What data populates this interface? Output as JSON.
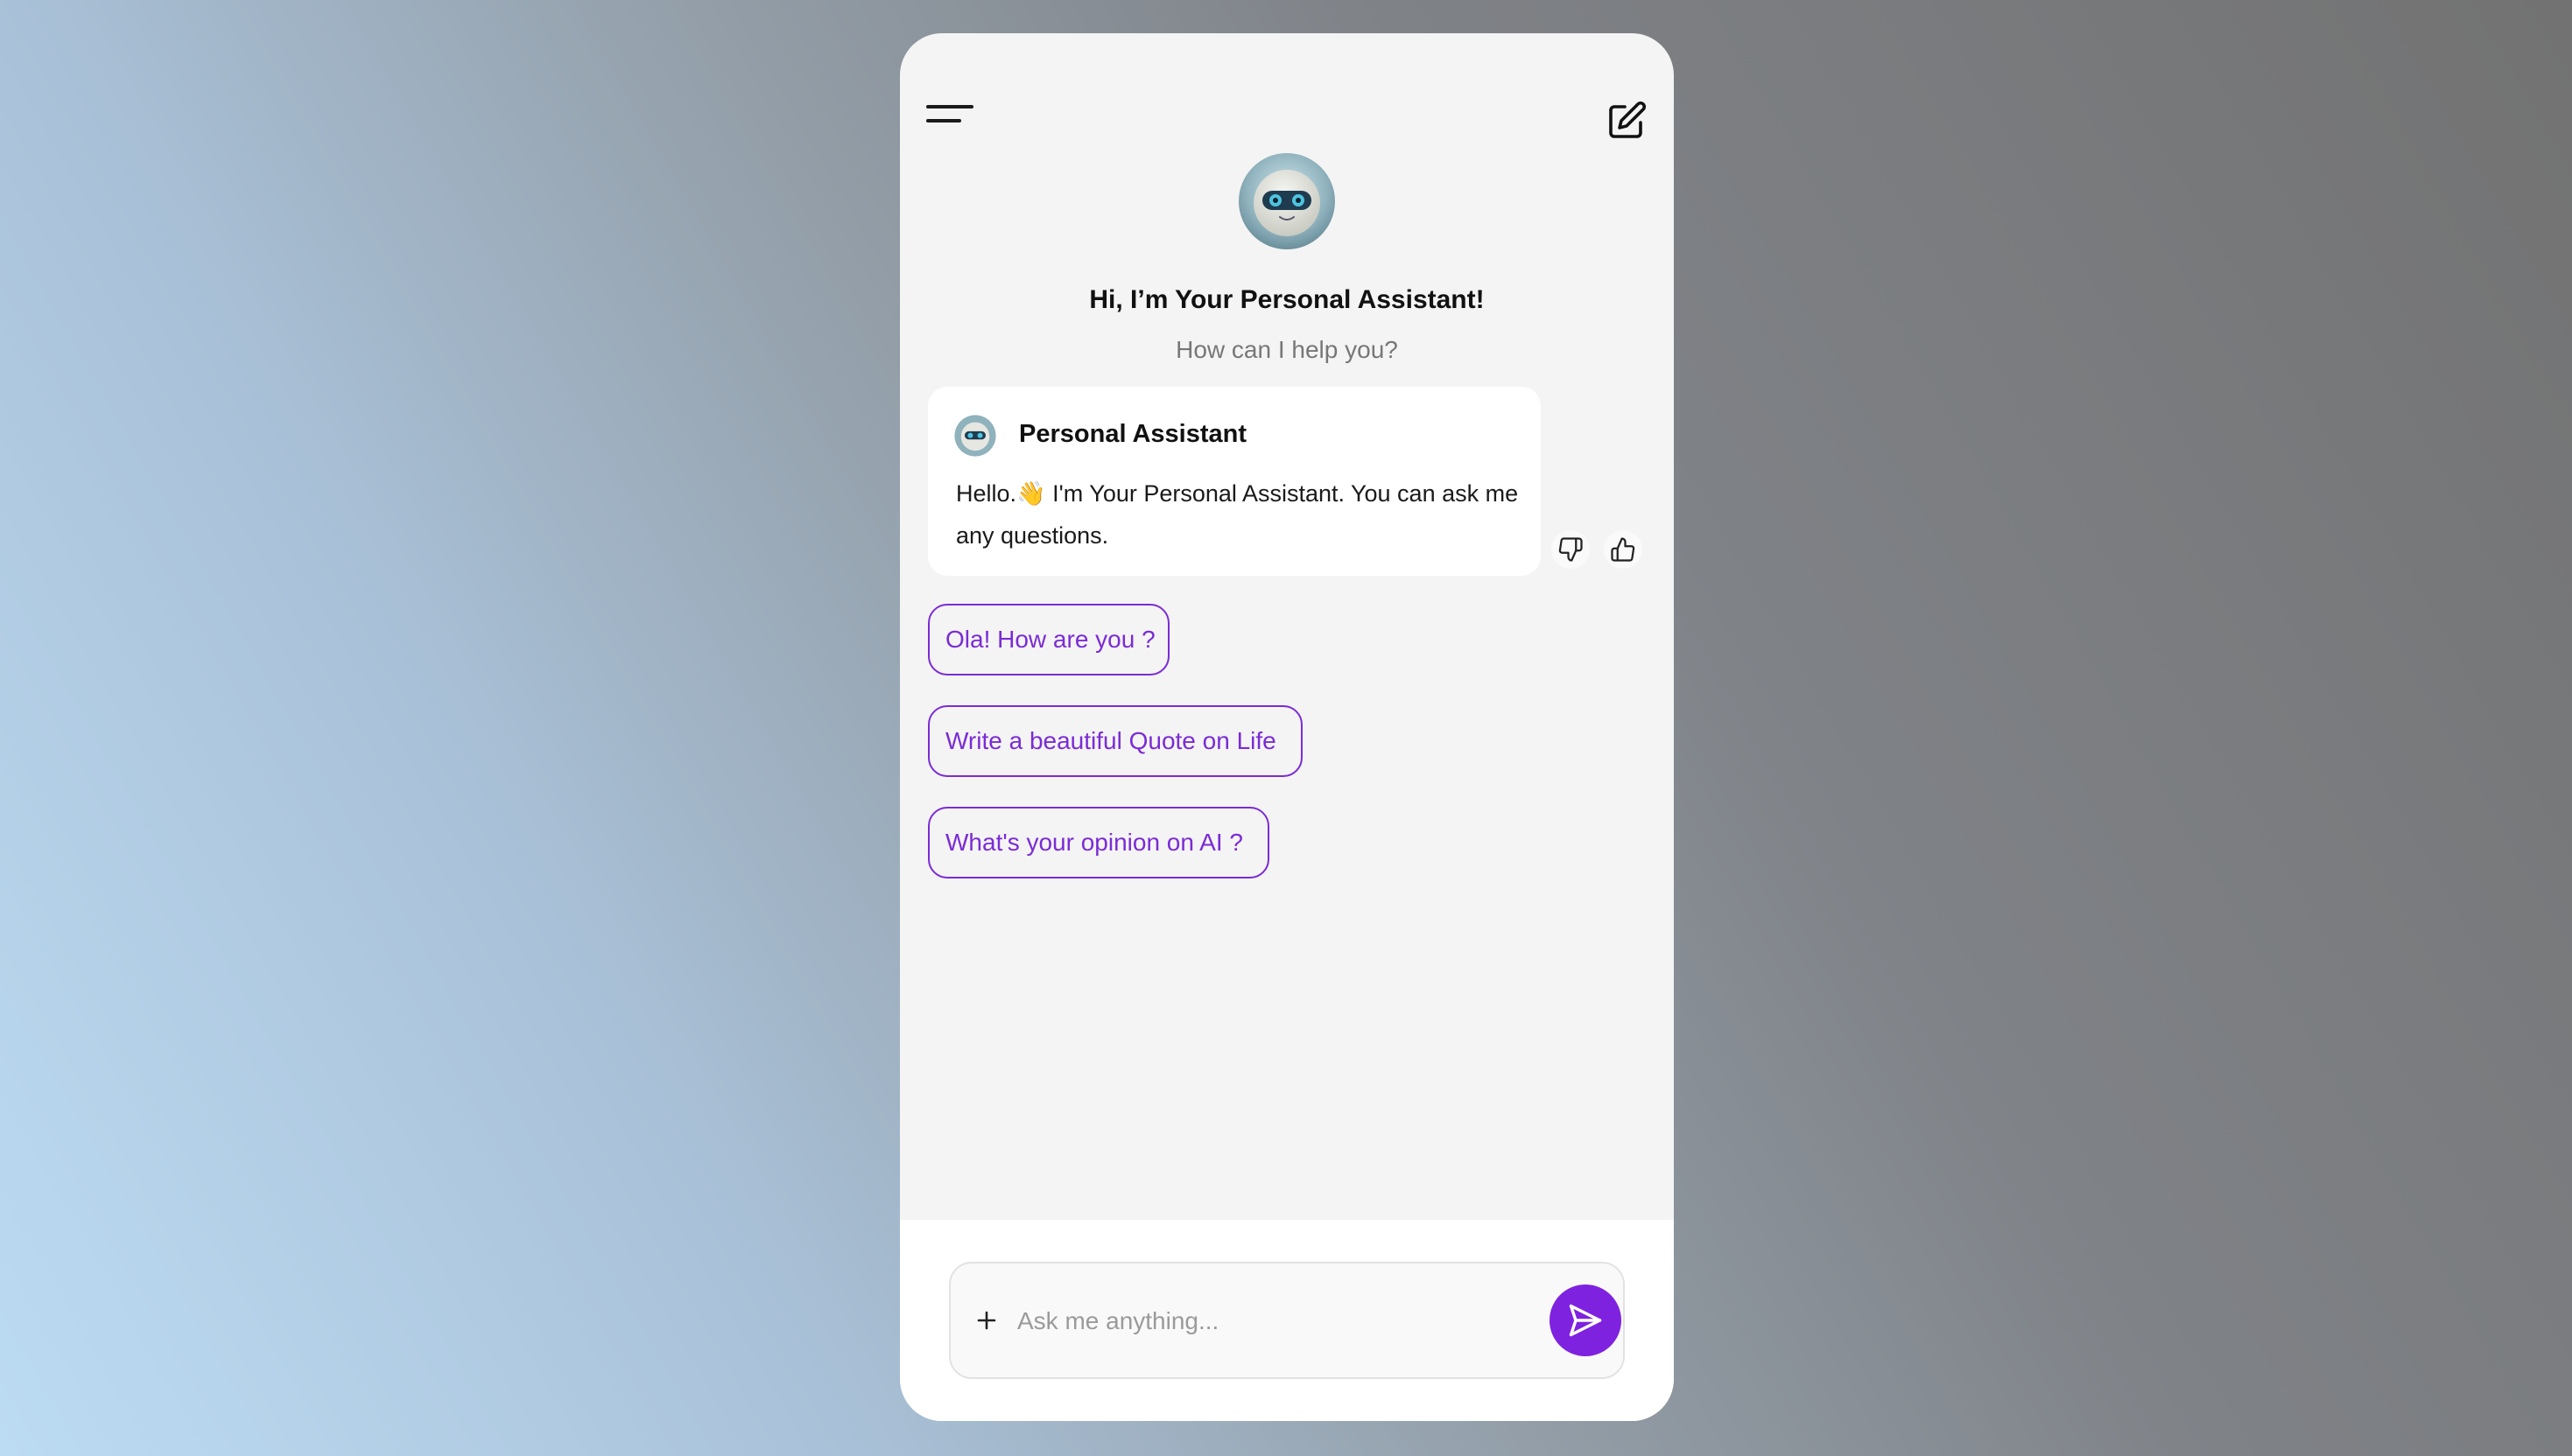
{
  "header": {
    "menu_icon": "hamburger-menu-icon",
    "new_chat_icon": "edit-icon"
  },
  "hero": {
    "avatar_icon": "robot-avatar",
    "title": "Hi, I’m Your Personal Assistant!",
    "subtitle": "How can I help you?"
  },
  "message": {
    "sender": "Personal Assistant",
    "text": "Hello.👋 I'm Your Personal Assistant. You can ask me any questions.",
    "feedback": [
      "thumbs-down-icon",
      "thumbs-up-icon"
    ]
  },
  "suggestions": [
    {
      "label": "Ola! How are you ?"
    },
    {
      "label": "Write a beautiful Quote on Life"
    },
    {
      "label": "What's your opinion on AI ?"
    }
  ],
  "composer": {
    "placeholder": "Ask me anything...",
    "value": "",
    "plus_icon": "plus-icon",
    "send_icon": "send-icon"
  },
  "colors": {
    "accent": "#7e22e0",
    "chip_text": "#7b2bd6",
    "panel_bg": "#f4f4f4"
  }
}
